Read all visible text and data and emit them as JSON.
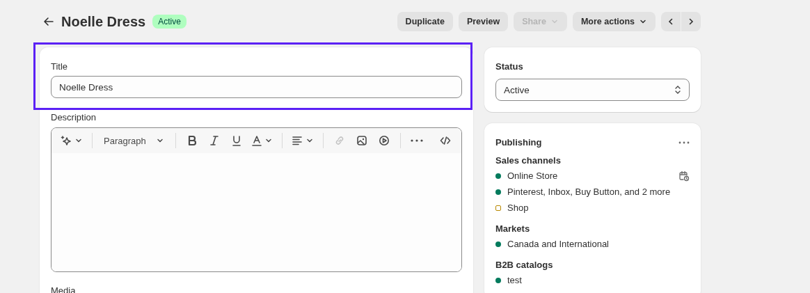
{
  "header": {
    "title": "Noelle Dress",
    "badge": "Active",
    "actions": [
      {
        "label": "Duplicate",
        "disabled": false,
        "has_caret": false
      },
      {
        "label": "Preview",
        "disabled": false,
        "has_caret": false
      },
      {
        "label": "Share",
        "disabled": true,
        "has_caret": true
      },
      {
        "label": "More actions",
        "disabled": false,
        "has_caret": true
      }
    ]
  },
  "title_field": {
    "label": "Title",
    "value": "Noelle Dress",
    "highlighted": true
  },
  "description": {
    "label": "Description",
    "toolbar": [
      {
        "kind": "ai",
        "disabled": false
      },
      {
        "kind": "divider"
      },
      {
        "kind": "paragraph",
        "label": "Paragraph",
        "disabled": false
      },
      {
        "kind": "divider"
      },
      {
        "kind": "bold",
        "disabled": false
      },
      {
        "kind": "italic",
        "disabled": false
      },
      {
        "kind": "underline",
        "disabled": false
      },
      {
        "kind": "color",
        "disabled": false
      },
      {
        "kind": "divider"
      },
      {
        "kind": "align",
        "disabled": false
      },
      {
        "kind": "divider"
      },
      {
        "kind": "link",
        "disabled": true
      },
      {
        "kind": "image",
        "disabled": false
      },
      {
        "kind": "video",
        "disabled": false
      },
      {
        "kind": "divider"
      },
      {
        "kind": "more",
        "disabled": false
      },
      {
        "kind": "spacer"
      },
      {
        "kind": "code",
        "disabled": false
      }
    ]
  },
  "media": {
    "label": "Media"
  },
  "status": {
    "label": "Status",
    "value": "Active"
  },
  "publishing": {
    "title": "Publishing",
    "sections": [
      {
        "heading": "Sales channels",
        "items": [
          {
            "name": "Online Store",
            "published": true,
            "color": "#047b5d",
            "scheduled": true
          },
          {
            "name": "Pinterest, Inbox, Buy Button, and 2 more",
            "published": true,
            "color": "#047b5d",
            "scheduled": false
          },
          {
            "name": "Shop",
            "published": false,
            "color": "#b98900",
            "scheduled": false
          }
        ]
      },
      {
        "heading": "Markets",
        "items": [
          {
            "name": "Canada and International",
            "published": true,
            "color": "#047b5d",
            "scheduled": false
          }
        ]
      },
      {
        "heading": "B2B catalogs",
        "items": [
          {
            "name": "test",
            "published": true,
            "color": "#047b5d",
            "scheduled": false
          }
        ]
      }
    ]
  }
}
